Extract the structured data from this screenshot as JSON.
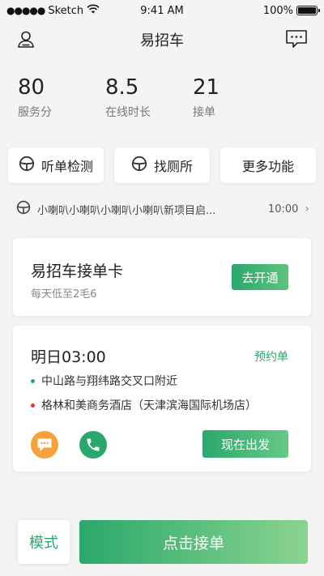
{
  "status_bar": {
    "signal_dots": "●●●●●",
    "carrier": "Sketch",
    "time": "9:41 AM",
    "battery": "100%"
  },
  "nav": {
    "title": "易招车",
    "left_icon": "user-icon",
    "right_icon": "message-icon"
  },
  "stats": [
    {
      "value": "80",
      "label": "服务分"
    },
    {
      "value": "8.5",
      "label": "在线时长"
    },
    {
      "value": "21",
      "label": "接单"
    }
  ],
  "quick_actions": [
    {
      "label": "听单检测",
      "icon": "steering-wheel-icon"
    },
    {
      "label": "找厕所",
      "icon": "steering-wheel-icon"
    },
    {
      "label": "更多功能"
    }
  ],
  "notice": {
    "icon": "steering-wheel-icon",
    "text": "小喇叭小喇叭小喇叭小喇叭新项目启...",
    "time": "10:00",
    "arrow": "›"
  },
  "promo_card": {
    "title": "易招车接单卡",
    "subtitle": "每天低至2毛6",
    "button": "去开通"
  },
  "order_card": {
    "time": "明日03:00",
    "type": "预约单",
    "from": "中山路与翔纬路交叉口附近",
    "to": "格林和美商务酒店（天津滨海国际机场店）",
    "go_button": "现在出发"
  },
  "bottom": {
    "mode": "模式",
    "take_order": "点击接单"
  },
  "colors": {
    "accent": "#2aa86b",
    "chat": "#f6a23a",
    "from_dot": "#2aa86b",
    "to_dot": "#e23a2a"
  }
}
